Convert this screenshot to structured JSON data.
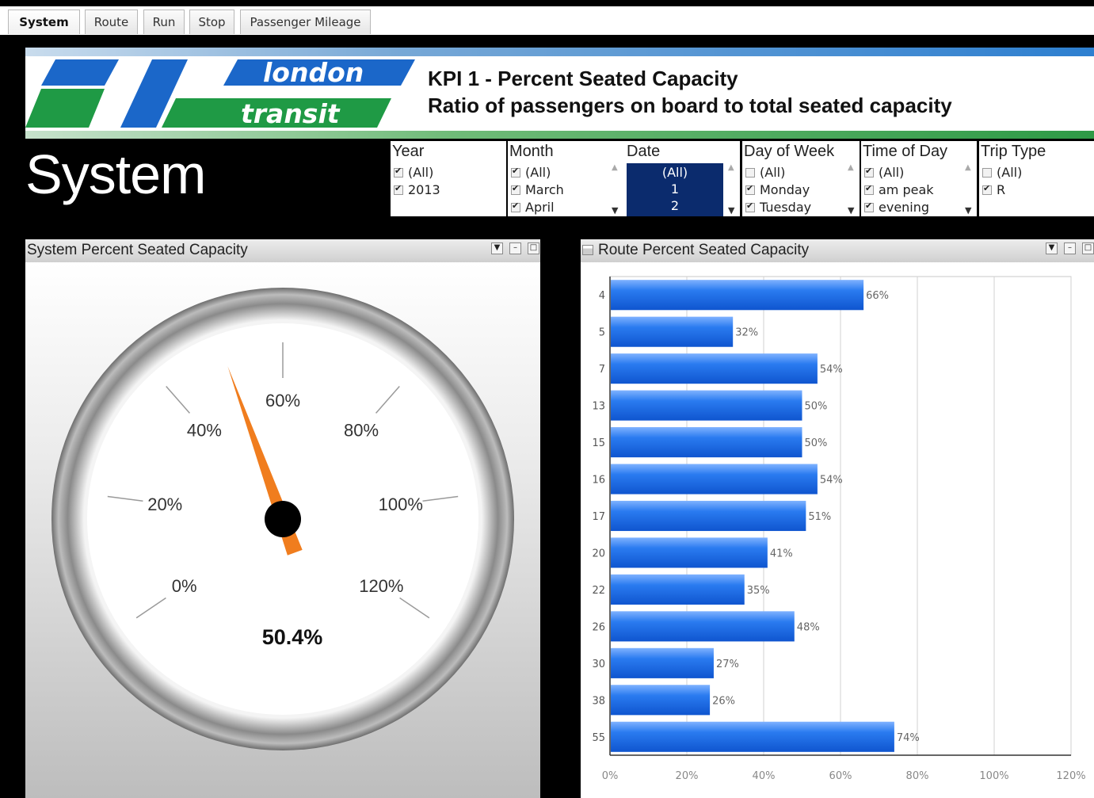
{
  "tabs": [
    {
      "label": "System",
      "active": true
    },
    {
      "label": "Route",
      "active": false
    },
    {
      "label": "Run",
      "active": false
    },
    {
      "label": "Stop",
      "active": false
    },
    {
      "label": "Passenger Mileage",
      "active": false
    }
  ],
  "banner": {
    "logo_word1": "london",
    "logo_word2": "transit",
    "kpi_title": "KPI 1 - Percent Seated Capacity",
    "kpi_subtitle": "Ratio of passengers on board to total seated capacity",
    "colors": {
      "blue": "#1b67c9",
      "green": "#1f9a45"
    }
  },
  "heading": "System",
  "filters": {
    "year": {
      "title": "Year",
      "items": [
        {
          "label": "(All)",
          "checked": true
        },
        {
          "label": "2013",
          "checked": true
        }
      ]
    },
    "month": {
      "title": "Month",
      "items": [
        {
          "label": "(All)",
          "checked": true
        },
        {
          "label": "March",
          "checked": true
        },
        {
          "label": "April",
          "checked": true
        }
      ]
    },
    "date": {
      "title": "Date",
      "items": [
        "(All)",
        "1",
        "2"
      ]
    },
    "day_of_week": {
      "title": "Day of Week",
      "items": [
        {
          "label": "(All)",
          "checked": false
        },
        {
          "label": "Monday",
          "checked": true
        },
        {
          "label": "Tuesday",
          "checked": true
        }
      ]
    },
    "time_of_day": {
      "title": "Time of Day",
      "items": [
        {
          "label": "(All)",
          "checked": true
        },
        {
          "label": "am peak",
          "checked": true
        },
        {
          "label": "evening",
          "checked": true
        }
      ]
    },
    "trip_type": {
      "title": "Trip Type",
      "items": [
        {
          "label": "(All)",
          "checked": false
        },
        {
          "label": "R",
          "checked": true
        }
      ]
    }
  },
  "gauge_panel": {
    "title": "System Percent Seated Capacity",
    "value": 50.4,
    "value_label": "50.4%",
    "min": 0,
    "max": 120,
    "tick_labels": [
      "0%",
      "20%",
      "40%",
      "60%",
      "80%",
      "100%",
      "120%"
    ],
    "needle_color": "#f07d1e"
  },
  "bar_panel": {
    "title": "Route Percent Seated Capacity",
    "bar_color": "#1f6fe0"
  },
  "chart_data": {
    "type": "bar",
    "orientation": "horizontal",
    "categories": [
      "4",
      "5",
      "7",
      "13",
      "15",
      "16",
      "17",
      "20",
      "22",
      "26",
      "30",
      "38",
      "55"
    ],
    "values": [
      66,
      32,
      54,
      50,
      50,
      54,
      51,
      41,
      35,
      48,
      27,
      26,
      74
    ],
    "data_labels": [
      "66%",
      "32%",
      "54%",
      "50%",
      "50%",
      "54%",
      "51%",
      "41%",
      "35%",
      "48%",
      "27%",
      "26%",
      "74%"
    ],
    "xlim": [
      0,
      120
    ],
    "x_ticks": [
      "0%",
      "20%",
      "40%",
      "60%",
      "80%",
      "100%",
      "120%"
    ],
    "grid": true
  }
}
